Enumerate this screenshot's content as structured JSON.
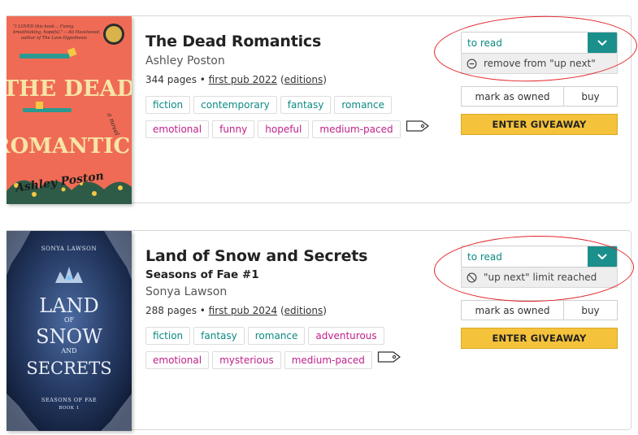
{
  "books": [
    {
      "title": "The Dead Romantics",
      "series": "",
      "author": "Ashley Poston",
      "pages": "344 pages",
      "sep": " • ",
      "first_pub": "first pub 2022",
      "editions_open": "(",
      "editions": "editions",
      "editions_close": ")",
      "cover": {
        "blurb_line1": "\"I LOVED this book... Funny,",
        "blurb_line2": "breathtaking, hopeful.\" —Ali Hazelwood,",
        "blurb_line3": "author of The Love Hypothesis",
        "title_line1": "THE DEAD",
        "title_line2": "ROMANTICS",
        "a_novel": "a novel",
        "author_script": "Ashley Poston"
      },
      "tags": [
        {
          "text": "fiction",
          "kind": "genre"
        },
        {
          "text": "contemporary",
          "kind": "genre"
        },
        {
          "text": "fantasy",
          "kind": "genre"
        },
        {
          "text": "romance",
          "kind": "genre"
        },
        {
          "text": "emotional",
          "kind": "mood"
        },
        {
          "text": "funny",
          "kind": "mood"
        },
        {
          "text": "hopeful",
          "kind": "mood"
        },
        {
          "text": "medium-paced",
          "kind": "pace"
        }
      ],
      "shelf": "to read",
      "up_next": "remove from \"up next\"",
      "up_next_icon": "minus-circle-icon",
      "owned": "mark as owned",
      "buy": "buy",
      "giveaway": "ENTER GIVEAWAY"
    },
    {
      "title": "Land of Snow and Secrets",
      "series": "Seasons of Fae #1",
      "author": "Sonya Lawson",
      "pages": "288 pages",
      "sep": " • ",
      "first_pub": "first pub 2024",
      "editions_open": "(",
      "editions": "editions",
      "editions_close": ")",
      "cover": {
        "author_caps": "SONYA LAWSON",
        "title_land": "LAND",
        "title_of": "OF",
        "title_snow": "SNOW",
        "title_and": "AND",
        "title_secrets": "SECRETS",
        "series_caps": "SEASONS OF FAE",
        "book_num": "BOOK 1"
      },
      "tags": [
        {
          "text": "fiction",
          "kind": "genre"
        },
        {
          "text": "fantasy",
          "kind": "genre"
        },
        {
          "text": "romance",
          "kind": "genre"
        },
        {
          "text": "adventurous",
          "kind": "mood"
        },
        {
          "text": "emotional",
          "kind": "mood"
        },
        {
          "text": "mysterious",
          "kind": "mood"
        },
        {
          "text": "medium-paced",
          "kind": "pace"
        }
      ],
      "shelf": "to read",
      "up_next": "\"up next\" limit reached",
      "up_next_icon": "no-entry-icon",
      "owned": "mark as owned",
      "buy": "buy",
      "giveaway": "ENTER GIVEAWAY"
    }
  ],
  "colors": {
    "teal": "#1a8f8c",
    "genre_text": "#0b8a82",
    "mood_text": "#c0208a",
    "giveaway_bg": "#f5c33b",
    "annotation_red": "#e2262b"
  }
}
